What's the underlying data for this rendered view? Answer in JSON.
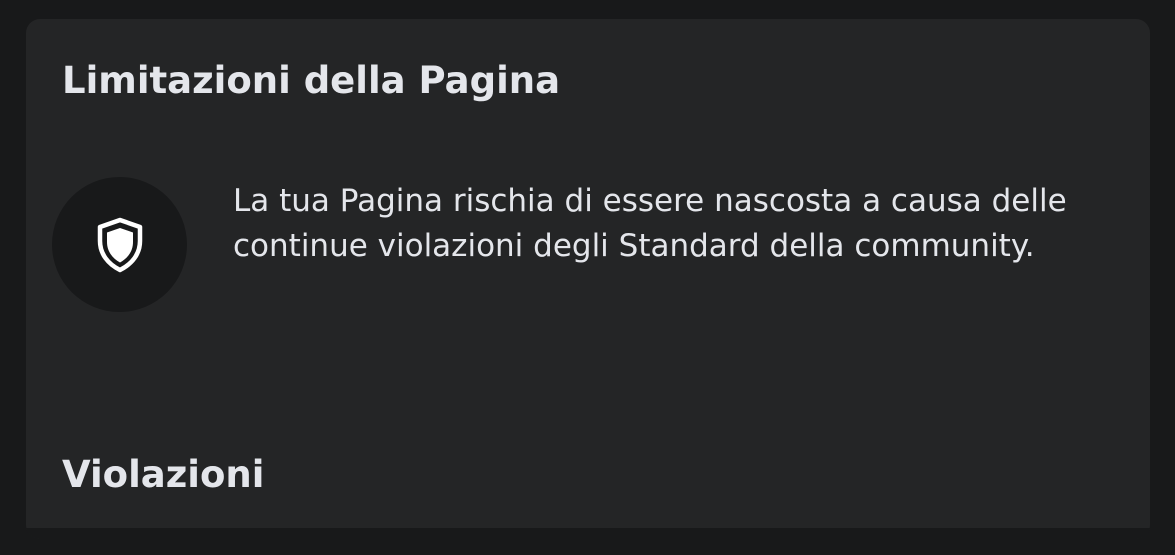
{
  "card": {
    "title": "Limitazioni della Pagina",
    "icon": "shield-icon",
    "message": "La tua Pagina rischia di essere nascosta a causa delle continue violazioni degli Standard della community.",
    "second_title": "Violazioni"
  },
  "colors": {
    "page_background": "#18191a",
    "card_background": "#242526",
    "text": "#e4e6eb",
    "icon_circle": "#18191a",
    "icon": "#ffffff"
  }
}
